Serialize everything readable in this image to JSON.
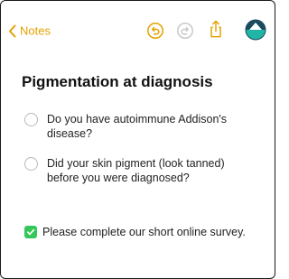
{
  "toolbar": {
    "back_label": "Notes",
    "icons": [
      "chevron-left-icon",
      "undo-icon",
      "redo-icon",
      "share-icon",
      "avatar"
    ],
    "accent_color": "#e3a200"
  },
  "note": {
    "title": "Pigmentation at diagnosis",
    "questions": [
      {
        "text": "Do you have autoimmune Addison's disease?",
        "checked": false
      },
      {
        "text": "Did your skin pigment (look tanned) before you were diagnosed?",
        "checked": false
      }
    ],
    "checklist": [
      {
        "text": "Please complete our short online survey.",
        "checked": true,
        "color": "#34c759"
      }
    ]
  }
}
